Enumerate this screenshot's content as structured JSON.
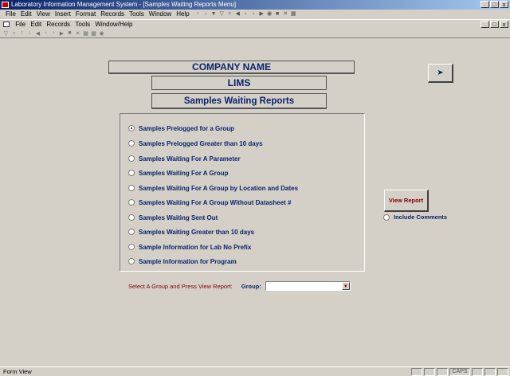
{
  "window": {
    "title": "Laboratory Information Management System - [Samples Waiting Reports Menu]",
    "controls": [
      "_",
      "□",
      "x"
    ]
  },
  "menubar": {
    "items": [
      "File",
      "Edit",
      "View",
      "Insert",
      "Format",
      "Records",
      "Tools",
      "Window",
      "Help"
    ]
  },
  "toolbar_menu": {
    "items": [
      "File",
      "Edit",
      "Records",
      "Tools",
      "Window/Help"
    ]
  },
  "form": {
    "company": "COMPANY NAME",
    "system": "LIMS",
    "title": "Samples Waiting Reports",
    "exit_icon": "exit-door-icon"
  },
  "options": {
    "selected_index": 0,
    "items": [
      "Samples Prelogged for a Group",
      "Samples Prelogged Greater than 10 days",
      "Samples Waiting For A Parameter",
      "Samples Waiting For A Group",
      "Samples Waiting For A Group by Location and Dates",
      "Samples Waiting For A Group Without Datasheet #",
      "Samples Waiting Sent Out",
      "Samples Waiting Greater than 10 days",
      "Sample Information for Lab No Prefix",
      "Sample Information for Program"
    ]
  },
  "actions": {
    "view_report": "View Report",
    "include_comments": "Include Comments"
  },
  "group_select": {
    "prompt": "Select A Group and Press View Report:",
    "label": "Group:",
    "value": ""
  },
  "statusbar": {
    "mode": "Form View",
    "caps": "CAPS"
  },
  "colors": {
    "title_blue": "#0a246a",
    "accent_maroon": "#800000",
    "face": "#d4d0c8"
  }
}
